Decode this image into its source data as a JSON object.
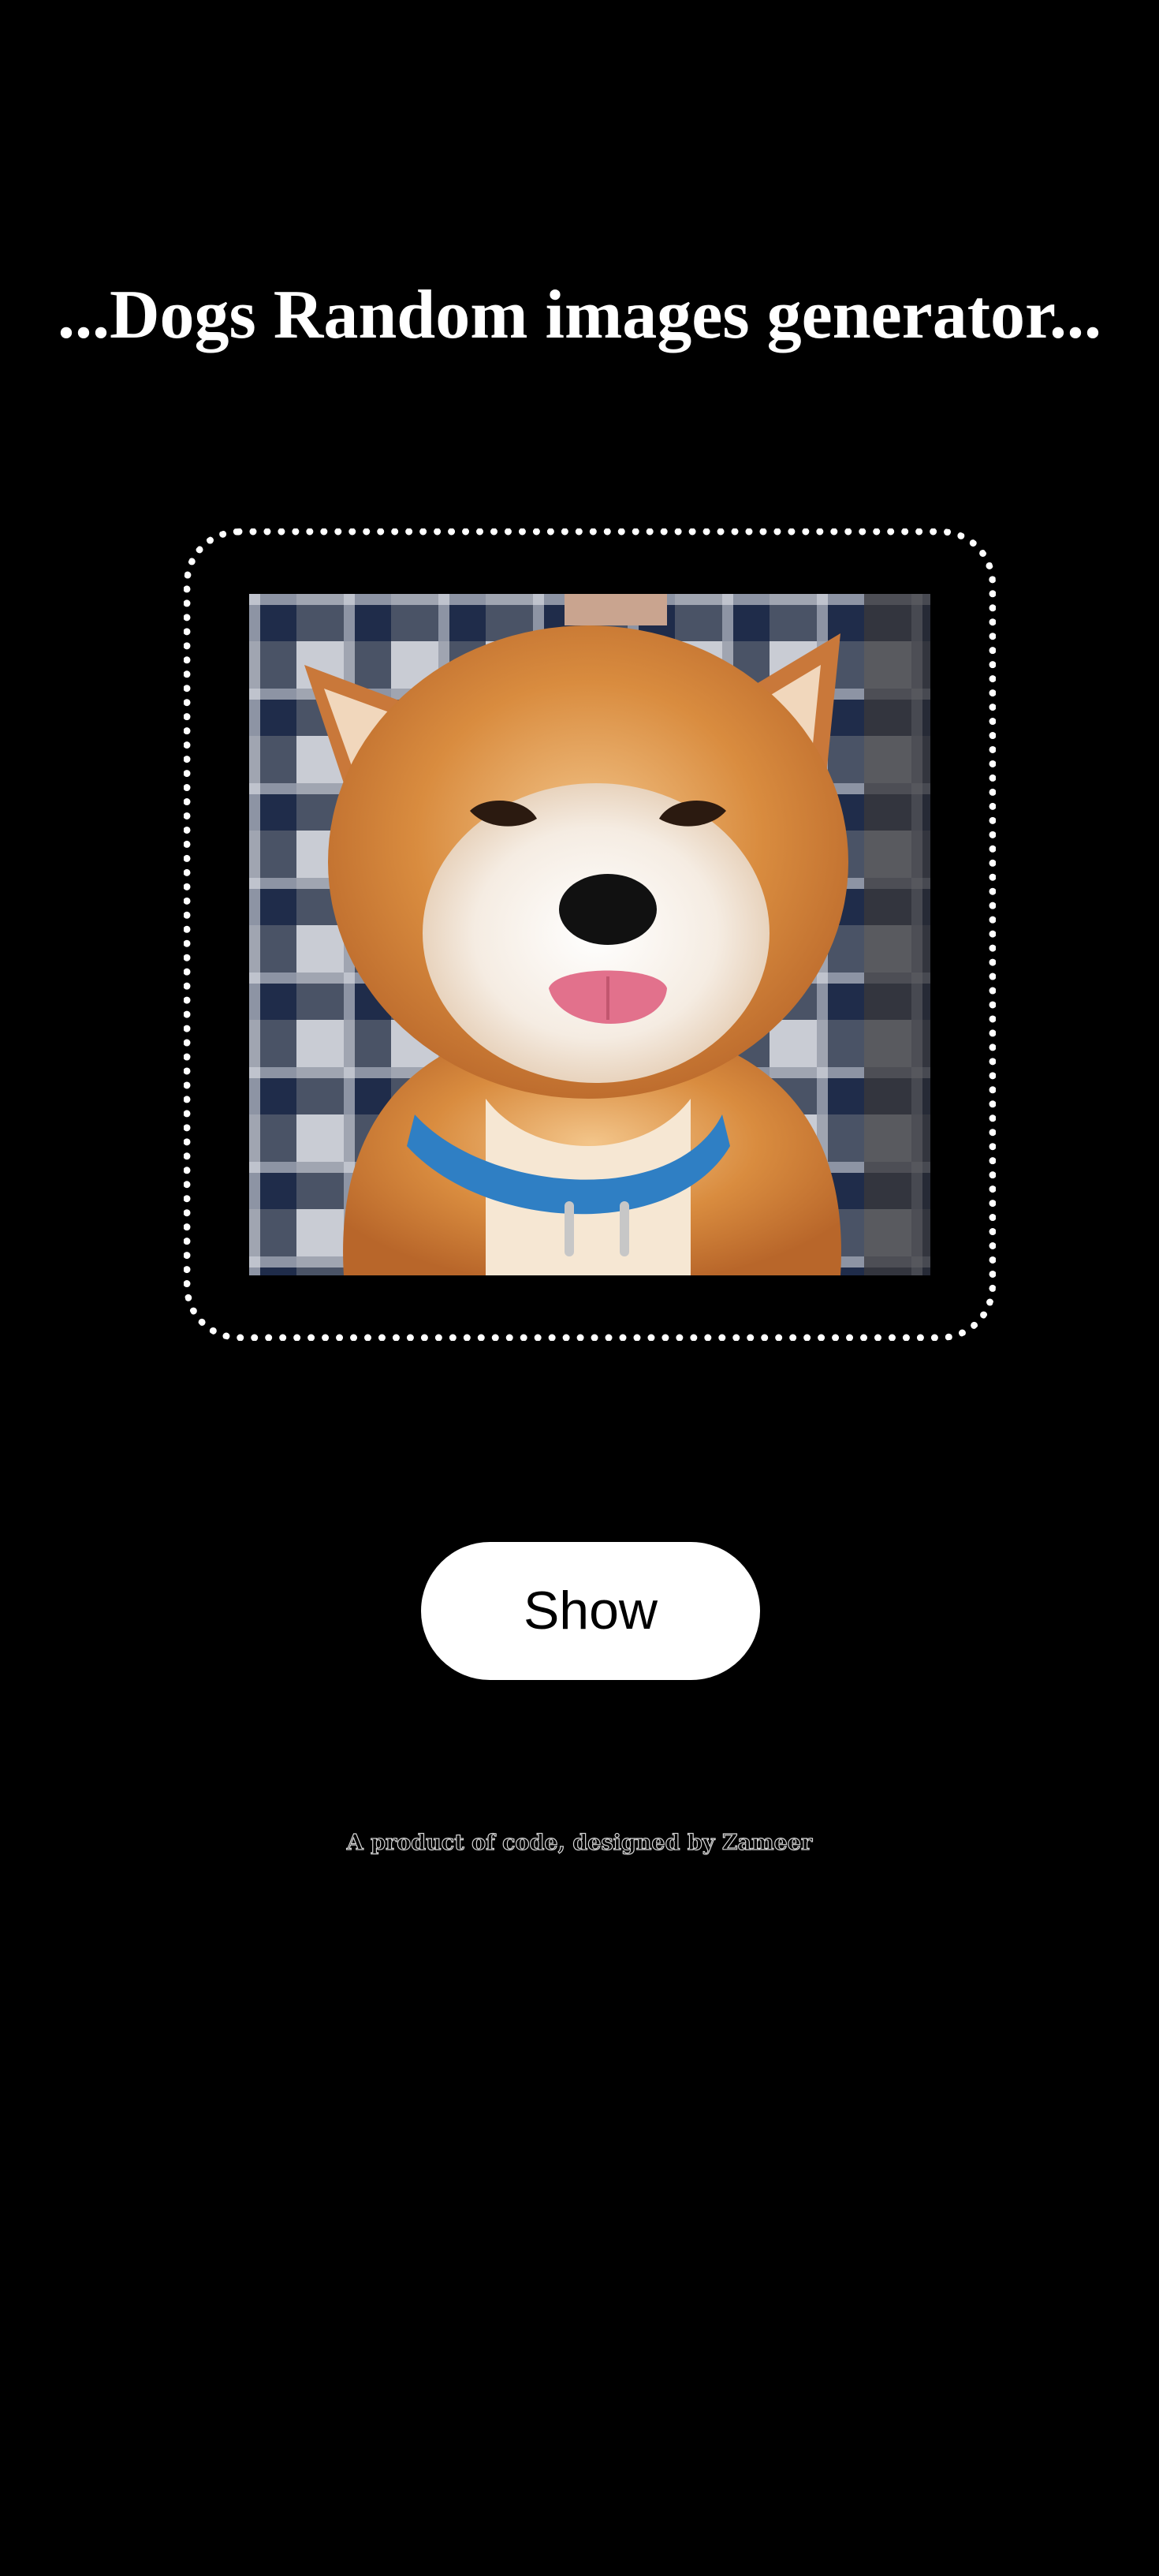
{
  "header": {
    "title": "...Dogs Random images generator..."
  },
  "image_panel": {
    "image_subject": "dog-photo",
    "frame_style": "dotted-white-border"
  },
  "controls": {
    "show_label": "Show"
  },
  "footer": {
    "credit": "A product of code, designed by Zameer"
  },
  "colors": {
    "background": "#000000",
    "text": "#ffffff",
    "button_bg": "#ffffff",
    "button_text": "#000000",
    "credit_outline": "#d6d6d6"
  }
}
